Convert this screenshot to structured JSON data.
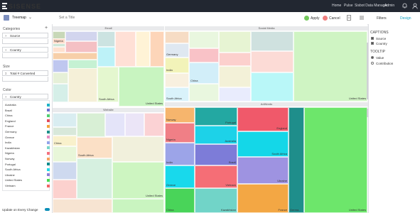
{
  "app": {
    "brand": "SISENSE",
    "nav": [
      "Home",
      "Pulse",
      "Sisbot Data Manager",
      "Admin"
    ]
  },
  "toolbar": {
    "widget_type": "Treemap",
    "title_placeholder": "Set a Title",
    "apply": "Apply",
    "cancel": "Cancel",
    "filters_tab": "Filters",
    "design_tab": "Design"
  },
  "left": {
    "categories_title": "Categories",
    "cat1": "Source",
    "cat2": "Country",
    "size_title": "Size",
    "size_field": "Total # Converted",
    "color_title": "Color",
    "color_field": "Country",
    "colors": [
      {
        "name": "Australia",
        "color": "#1fb4c8"
      },
      {
        "name": "Brazil",
        "color": "#6a6fcf"
      },
      {
        "name": "China",
        "color": "#4fcf6f"
      },
      {
        "name": "England",
        "color": "#e24c5d"
      },
      {
        "name": "France",
        "color": "#f3a43b"
      },
      {
        "name": "Germany",
        "color": "#1d8f8a"
      },
      {
        "name": "Greece",
        "color": "#e78cc1"
      },
      {
        "name": "India",
        "color": "#92a3ea"
      },
      {
        "name": "Kazakhstan",
        "color": "#76d5c9"
      },
      {
        "name": "Nigeria",
        "color": "#f4717f"
      },
      {
        "name": "Norway",
        "color": "#f7a25d"
      },
      {
        "name": "Portugal",
        "color": "#0f8b8c"
      },
      {
        "name": "South Africa",
        "color": "#22d8e8"
      },
      {
        "name": "Ukraine",
        "color": "#8b7fd6"
      },
      {
        "name": "United States",
        "color": "#45db52"
      },
      {
        "name": "Vietnam",
        "color": "#f36464"
      }
    ],
    "update_label": "Update on Every Change"
  },
  "right": {
    "captions_title": "CAPTIONS",
    "cap1": "Source",
    "cap2": "Country",
    "tooltip_title": "TOOLTIP",
    "tip1": "Value",
    "tip2": "Contribution"
  },
  "treemap": {
    "groups": [
      "Email",
      "Social Media",
      "Website",
      "AdWords"
    ],
    "labels": {
      "email_nigeria": "Nigeria",
      "email_sa": "South Africa",
      "email_us": "United States",
      "sm_germany": "Germany",
      "sm_india": "India",
      "sm_china": "China",
      "sm_sa": "South Africa",
      "sm_us": "United States",
      "web_china": "China",
      "web_sa": "South Africa",
      "web_us": "United States",
      "ad_norway": "Norway",
      "ad_portugal": "Portugal",
      "ad_england": "England",
      "ad_nigeria": "Nigeria",
      "ad_australia": "Australia",
      "ad_india": "India",
      "ad_brazil": "Brazil",
      "ad_sa": "South Africa",
      "ad_greece": "Greece",
      "ad_vietnam": "Vietnam",
      "ad_ukraine": "Ukraine",
      "ad_china": "China",
      "ad_kaz": "Kazakhstan",
      "ad_france": "France",
      "ad_germany": "Germa...",
      "ad_us": "United States"
    }
  }
}
